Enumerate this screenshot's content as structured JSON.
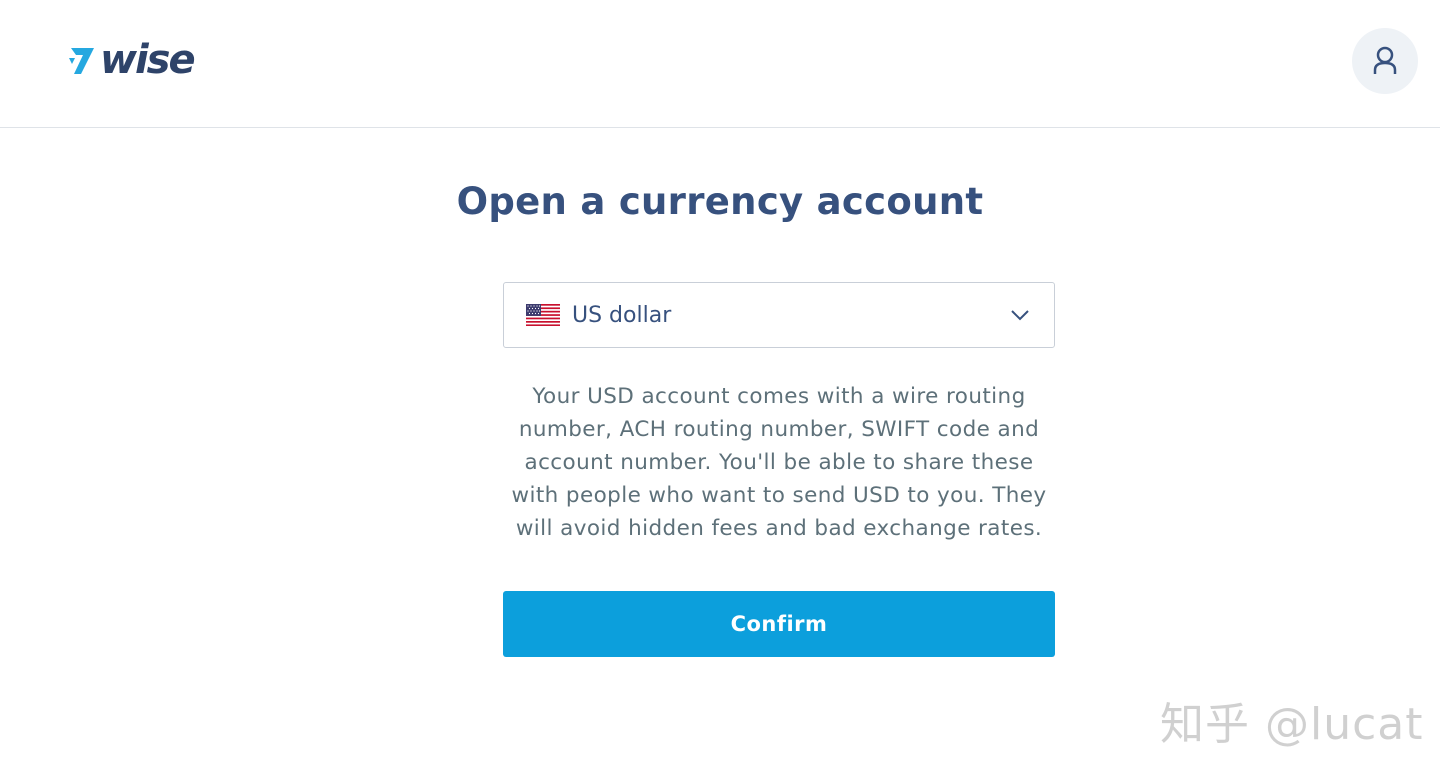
{
  "header": {
    "logo_text": "wise",
    "logo_icon": "wise-flag-icon",
    "profile_icon": "user-icon"
  },
  "main": {
    "title": "Open a currency account",
    "currency_select": {
      "flag_icon": "us-flag-icon",
      "value": "US dollar",
      "chevron_icon": "chevron-down-icon"
    },
    "description": "Your USD account comes with a wire routing number, ACH routing number, SWIFT code and account number. You'll be able to share these with people who want to send USD to you. They will avoid hidden fees and bad exchange rates.",
    "confirm_label": "Confirm"
  },
  "watermark": "知乎 @lucat",
  "colors": {
    "brand_navy": "#37517e",
    "accent_blue": "#0c9fdc",
    "logo_cyan": "#25a8e0"
  }
}
